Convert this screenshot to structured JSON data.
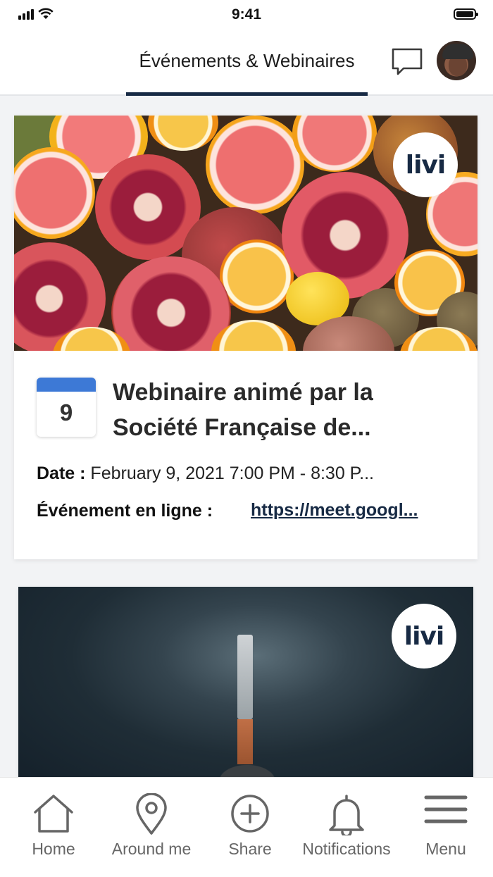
{
  "status_bar": {
    "time": "9:41"
  },
  "header": {
    "tab_title": "Événements & Webinaires"
  },
  "events": [
    {
      "brand_badge": "livi",
      "day": "9",
      "title": "Webinaire animé par la Société Française de...",
      "date_label": "Date :",
      "date_value": "February 9, 2021 7:00 PM - 8:30 P...",
      "online_label": "Événement en ligne :",
      "online_link": "https://meet.googl..."
    },
    {
      "brand_badge": "livi"
    }
  ],
  "bottom_nav": [
    {
      "label": "Home",
      "icon": "home-icon"
    },
    {
      "label": "Around me",
      "icon": "location-pin-icon"
    },
    {
      "label": "Share",
      "icon": "plus-circle-icon"
    },
    {
      "label": "Notifications",
      "icon": "bell-icon"
    },
    {
      "label": "Menu",
      "icon": "hamburger-menu-icon"
    }
  ],
  "colors": {
    "brand_navy": "#172a44",
    "calendar_blue": "#3d79d6",
    "nav_gray": "#666666"
  }
}
